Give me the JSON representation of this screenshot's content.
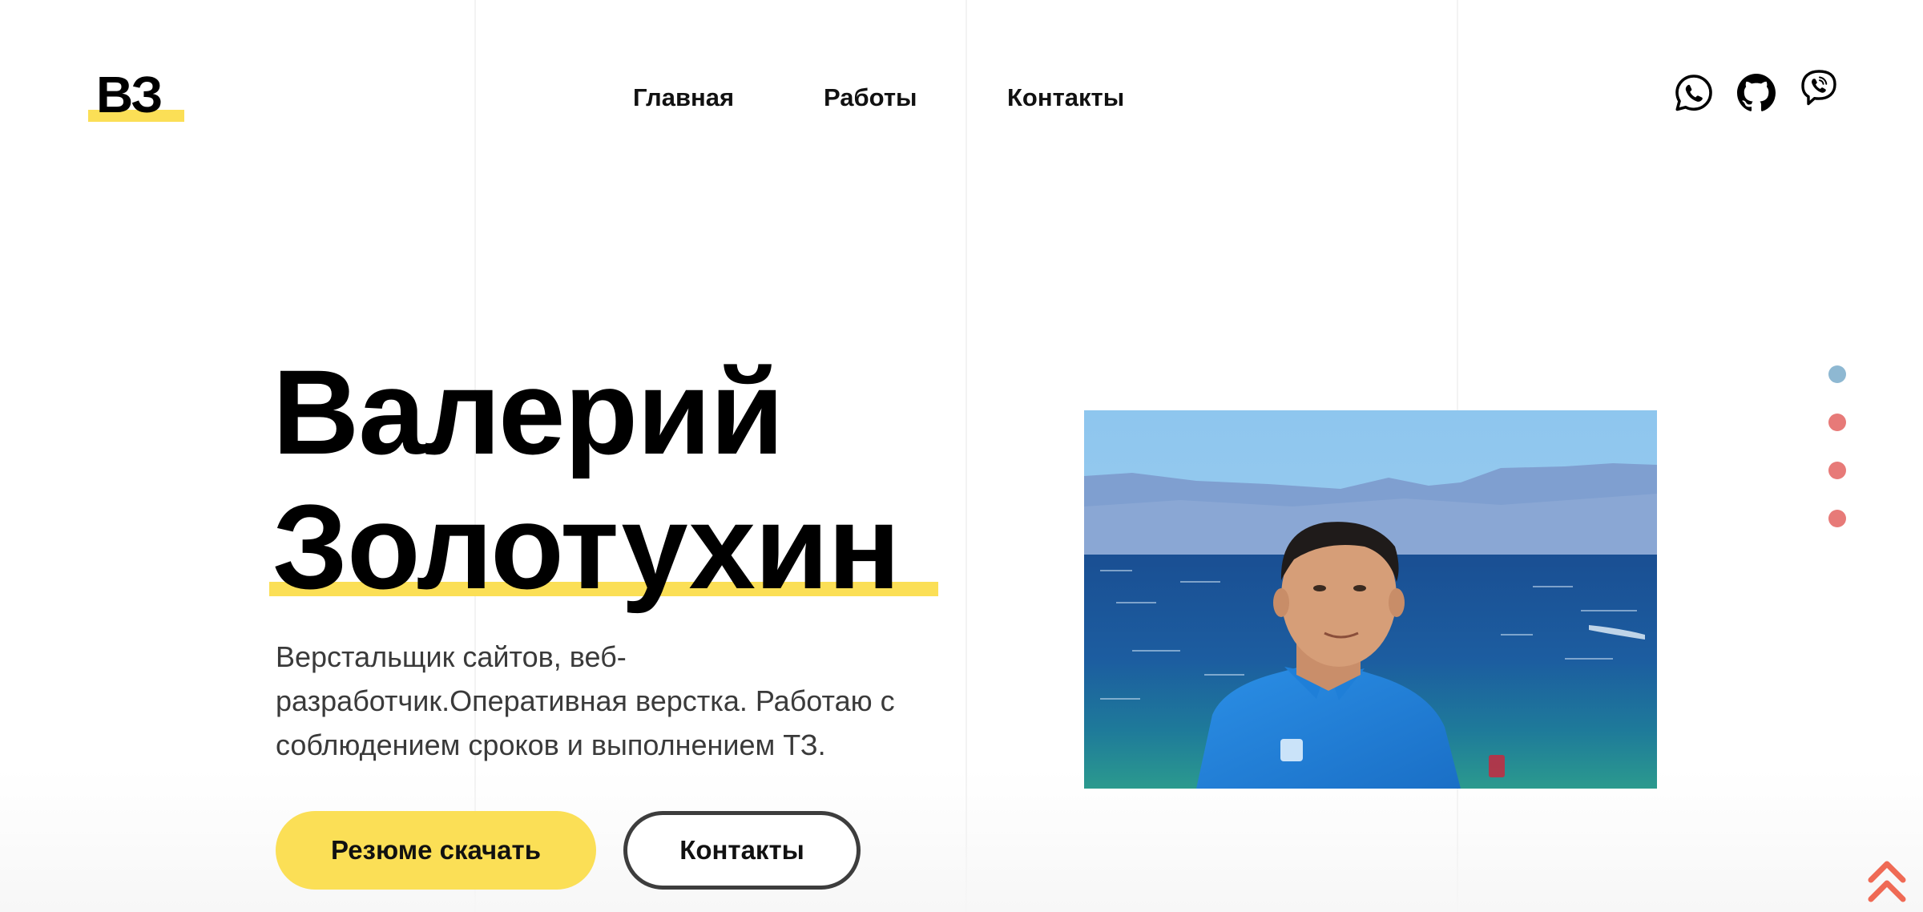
{
  "logo": {
    "text": "ВЗ"
  },
  "nav": {
    "items": [
      {
        "label": "Главная"
      },
      {
        "label": "Работы"
      },
      {
        "label": "Контакты"
      }
    ]
  },
  "socials": {
    "items": [
      {
        "icon": "whatsapp-icon"
      },
      {
        "icon": "github-icon"
      },
      {
        "icon": "viber-icon"
      }
    ]
  },
  "hero": {
    "first_name": "Валерий",
    "last_name": "Золотухин",
    "description": "Верстальщик сайтов, веб-разработчик.Оперативная верстка. Работаю с соблюдением сроков и выполнением ТЗ.",
    "resume_button": "Резюме скачать",
    "contacts_button": "Контакты"
  },
  "pagination": {
    "active_index": 0,
    "count": 4
  },
  "colors": {
    "accent_yellow": "#fbdf56",
    "dot_active": "#8eb8d2",
    "dot_inactive": "#e77a78",
    "scroll_top": "#ef6a55"
  }
}
